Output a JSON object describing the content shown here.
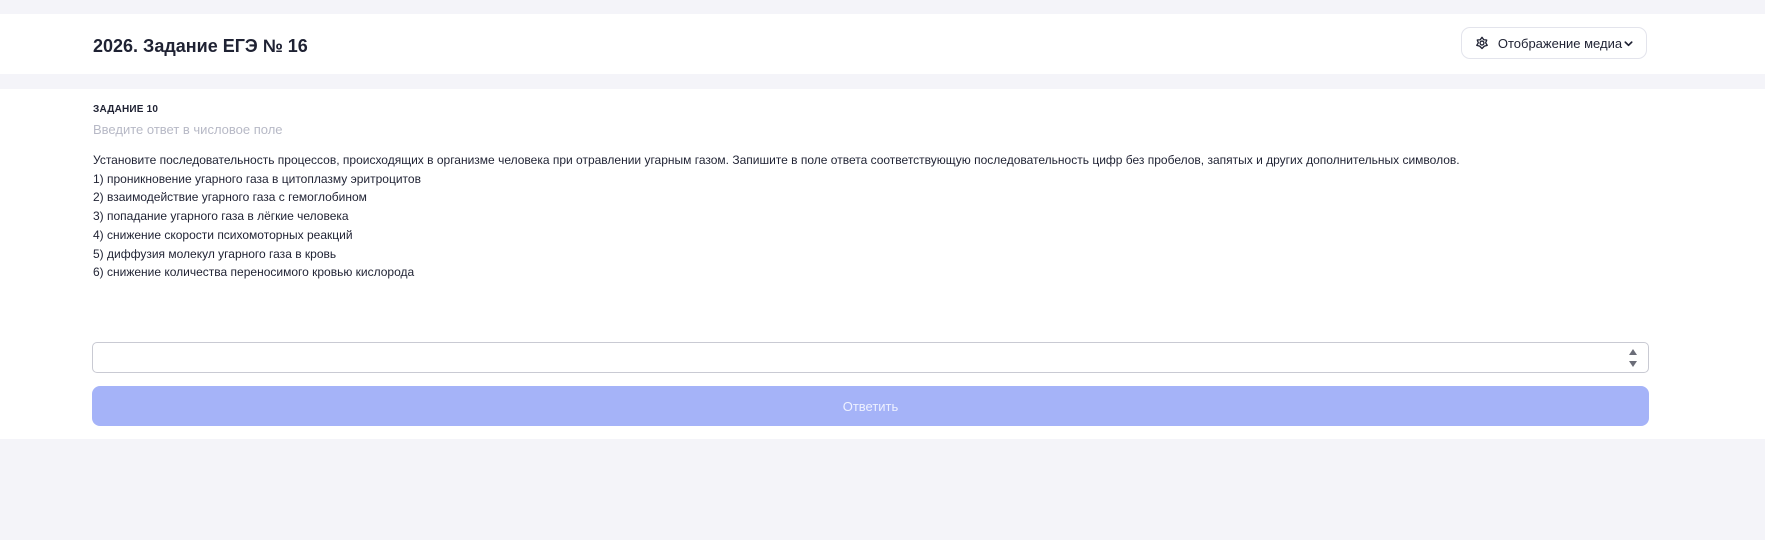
{
  "header": {
    "title": "2026. Задание ЕГЭ № 16",
    "media_button": {
      "label": "Отображение медиа",
      "icon": "flower-icon",
      "chevron_icon": "chevron-down-icon"
    }
  },
  "task": {
    "number_label": "ЗАДАНИЕ 10",
    "hint": "Введите ответ в числовое поле",
    "question": "Установите последовательность процессов, происходящих в организме человека при отравлении угарным газом. Запишите в поле ответа соответствующую последовательность цифр без пробелов, запятых и других дополнительных символов.",
    "options": [
      "1) проникновение угарного газа в цитоплазму эритроцитов",
      "2) взаимодействие угарного газа с гемоглобином",
      "3) попадание угарного газа в лёгкие человека",
      "4) снижение скорости психомоторных реакций",
      "5) диффузия молекул угарного газа в кровь",
      "6) снижение количества переносимого кровью кислорода"
    ],
    "answer_value": "",
    "submit_label": "Ответить"
  },
  "colors": {
    "page_background": "#f4f4f9",
    "card_background": "#ffffff",
    "submit_button_disabled": "#a5b3f8",
    "hint_text": "#b7b9c6"
  }
}
